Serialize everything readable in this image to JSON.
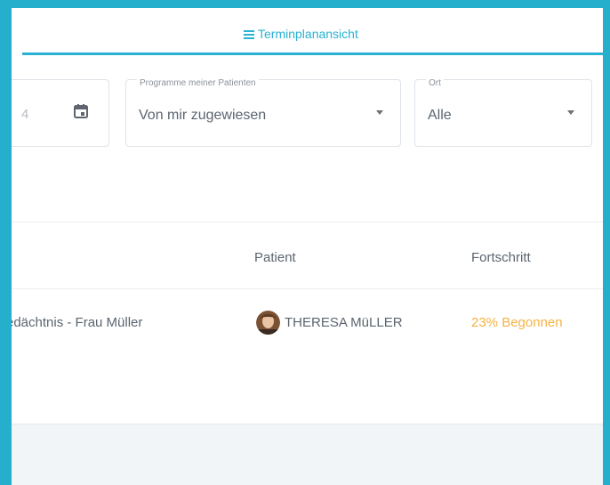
{
  "tabs": {
    "active_label": "Terminplanansicht",
    "active_icon": "list-icon",
    "accent": "#29b2d3"
  },
  "filters": {
    "date_partial": "4",
    "programs": {
      "label": "Programme meiner Patienten",
      "value": "Von mir zugewiesen"
    },
    "location": {
      "label": "Ort",
      "value": "Alle"
    }
  },
  "table": {
    "headers": {
      "patient": "Patient",
      "progress": "Fortschritt"
    },
    "rows": [
      {
        "program": "edächtnis - Frau Müller",
        "patient": "THERESA MüLLER",
        "progress": 0.23,
        "progress_text": "23% Begonnen",
        "progress_color": "#f4b344"
      }
    ]
  }
}
